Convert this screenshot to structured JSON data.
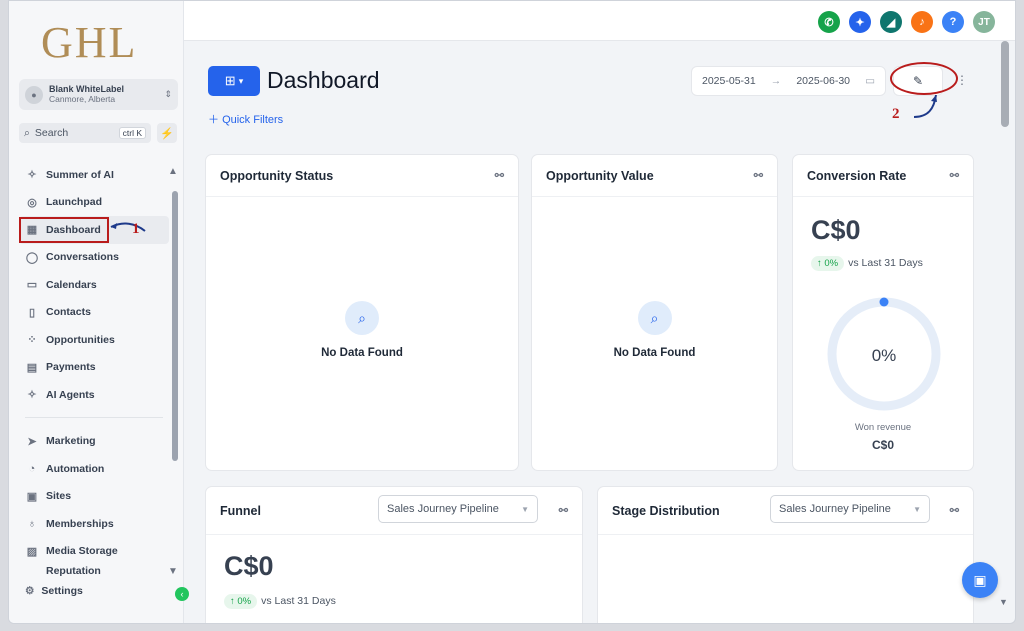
{
  "brand": {
    "logo_text": "GHL"
  },
  "account": {
    "name": "Blank WhiteLabel",
    "location": "Canmore, Alberta"
  },
  "search": {
    "placeholder": "Search",
    "shortcut": "ctrl K"
  },
  "nav": {
    "items": [
      {
        "label": "Summer of AI",
        "icon": "sparkle-icon"
      },
      {
        "label": "Launchpad",
        "icon": "rocket-icon"
      },
      {
        "label": "Dashboard",
        "icon": "grid-icon"
      },
      {
        "label": "Conversations",
        "icon": "chat-icon"
      },
      {
        "label": "Calendars",
        "icon": "calendar-icon"
      },
      {
        "label": "Contacts",
        "icon": "contacts-icon"
      },
      {
        "label": "Opportunities",
        "icon": "opportunities-icon"
      },
      {
        "label": "Payments",
        "icon": "payments-icon"
      },
      {
        "label": "AI Agents",
        "icon": "ai-agents-icon"
      }
    ],
    "items2": [
      {
        "label": "Marketing",
        "icon": "send-icon"
      },
      {
        "label": "Automation",
        "icon": "automation-icon"
      },
      {
        "label": "Sites",
        "icon": "sites-icon"
      },
      {
        "label": "Memberships",
        "icon": "memberships-icon"
      },
      {
        "label": "Media Storage",
        "icon": "media-icon"
      },
      {
        "label": "Reputation",
        "icon": "reputation-icon"
      }
    ],
    "settings": "Settings"
  },
  "annotations": {
    "one": "1",
    "two": "2"
  },
  "topbar": {
    "icons": [
      "phone-icon",
      "magic-icon",
      "megaphone-icon",
      "bell-icon",
      "help-icon"
    ],
    "avatar": "JT"
  },
  "header": {
    "title": "Dashboard",
    "quick_filters": "Quick Filters",
    "date_start": "2025-05-31",
    "date_end": "2025-06-30"
  },
  "cards": {
    "opportunity_status": {
      "title": "Opportunity Status",
      "empty": "No Data Found"
    },
    "opportunity_value": {
      "title": "Opportunity Value",
      "empty": "No Data Found"
    },
    "conversion_rate": {
      "title": "Conversion Rate",
      "value": "C$0",
      "delta": "↑ 0%",
      "vs": "vs Last 31 Days",
      "gauge": "0%",
      "won_label": "Won revenue",
      "won_value": "C$0",
      "gauge_fraction": 0
    },
    "funnel": {
      "title": "Funnel",
      "pipeline": "Sales Journey Pipeline",
      "value": "C$0",
      "delta": "↑ 0%",
      "vs": "vs Last 31 Days"
    },
    "stage_distribution": {
      "title": "Stage Distribution",
      "pipeline": "Sales Journey Pipeline"
    }
  },
  "colors": {
    "accent": "#2563eb",
    "annotation": "#b91c1c",
    "brand": "#b08d57"
  }
}
